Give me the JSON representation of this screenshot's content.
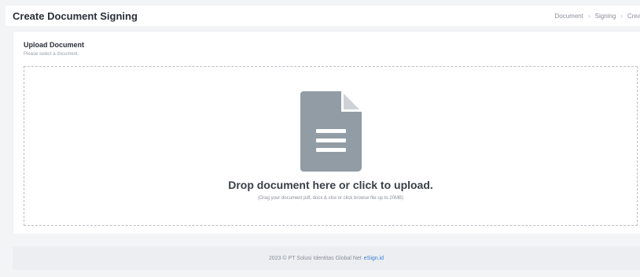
{
  "header": {
    "title": "Create Document Signing",
    "breadcrumb": [
      "Document",
      "Signing",
      "Create"
    ]
  },
  "upload": {
    "title": "Upload Document",
    "subtitle": "Please select a document.",
    "drop_title": "Drop document here or click to upload.",
    "drop_hint": "(Drag your document pdf, docx & xlsx or click browse file up to 20MB)",
    "icon": "file-document-icon",
    "icon_color": "#929ca5"
  },
  "footer": {
    "copyright": "2023 © PT Solusi Identitas Global Net",
    "brand_link": "eSign.id",
    "link_color": "#3b7ddd"
  }
}
